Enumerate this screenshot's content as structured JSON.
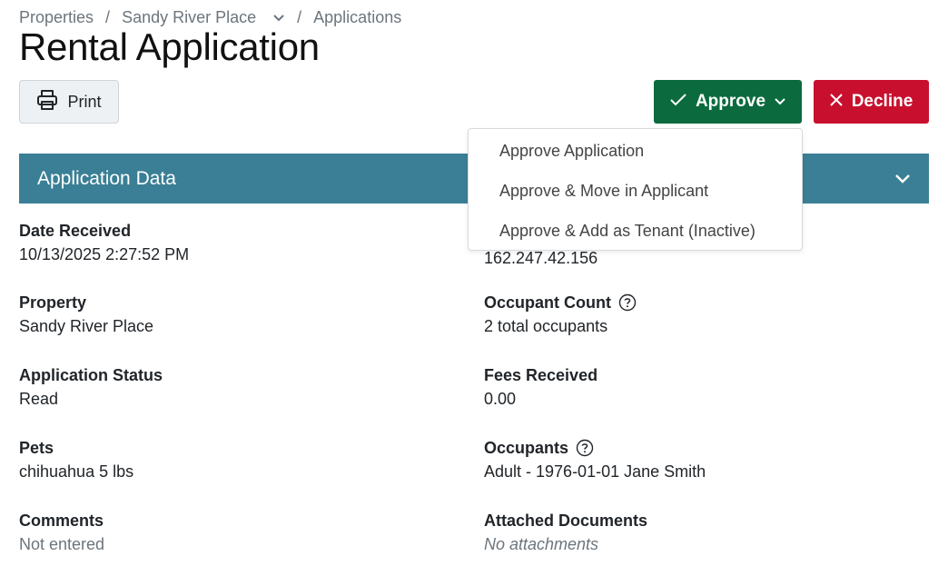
{
  "breadcrumb": {
    "items": [
      "Properties",
      "Sandy River Place",
      "Applications"
    ],
    "separator": "/"
  },
  "page_title": "Rental Application",
  "toolbar": {
    "print_label": "Print",
    "approve_label": "Approve",
    "decline_label": "Decline"
  },
  "approve_menu": {
    "items": [
      "Approve Application",
      "Approve & Move in Applicant",
      "Approve & Add as Tenant (Inactive)"
    ]
  },
  "section": {
    "title": "Application Data"
  },
  "fields": {
    "date_received": {
      "label": "Date Received",
      "value": "10/13/2025 2:27:52 PM"
    },
    "ip_address": {
      "value": "162.247.42.156"
    },
    "property": {
      "label": "Property",
      "value": "Sandy River Place"
    },
    "occupant_count": {
      "label": "Occupant Count",
      "value": "2 total occupants"
    },
    "application_status": {
      "label": "Application Status",
      "value": "Read"
    },
    "fees_received": {
      "label": "Fees Received",
      "value": "0.00"
    },
    "pets": {
      "label": "Pets",
      "value": "chihuahua 5 lbs"
    },
    "occupants": {
      "label": "Occupants",
      "value": "Adult - 1976-01-01 Jane Smith"
    },
    "comments": {
      "label": "Comments",
      "value": "Not entered"
    },
    "attached_documents": {
      "label": "Attached Documents",
      "value": "No attachments"
    }
  },
  "colors": {
    "approve": "#0b6b3e",
    "decline": "#c8102e",
    "section_header": "#3a7f95"
  }
}
